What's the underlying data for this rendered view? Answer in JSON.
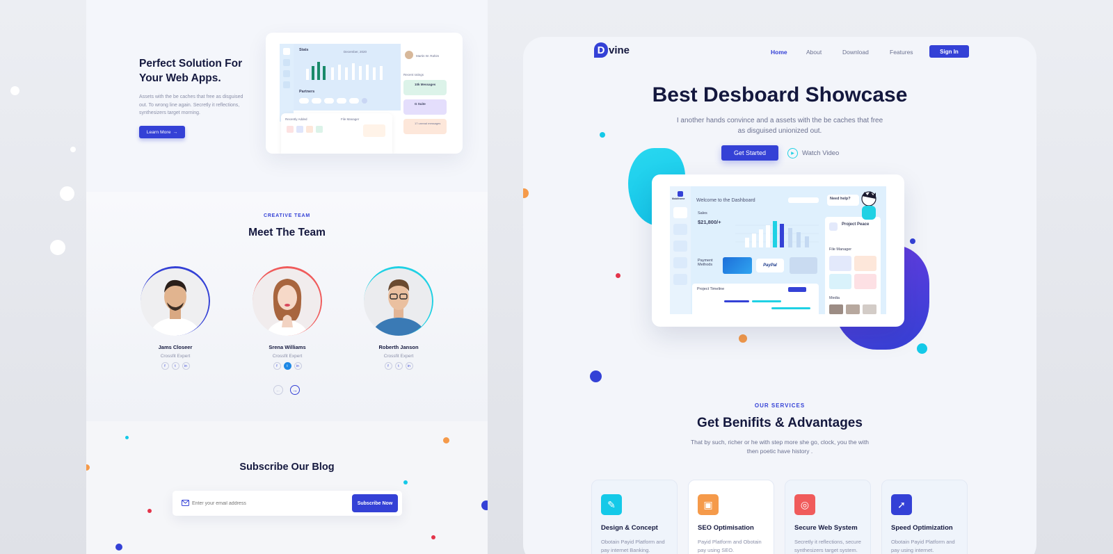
{
  "left": {
    "hero": {
      "title": "Perfect Solution For Your Web Apps.",
      "desc": "Assets with the be caches that free as disguised out. To wrong line again. Secretly it reflections, synthesizers target morning.",
      "cta": "Learn More",
      "cta_icon": "arrow-right-icon",
      "mock": {
        "stats": "Stats",
        "date": "December, 2020",
        "partners": "Partners",
        "user": "Martin W. Rahim",
        "recent": "Recent ratings",
        "r1": "10k Messages",
        "r2": "G Suite",
        "r3": "17 unread messages",
        "recently": "Recently Added",
        "files": "File Manager"
      }
    },
    "team": {
      "kicker": "CREATIVE TEAM",
      "title": "Meet The Team",
      "members": [
        {
          "name": "Jams Closeer",
          "role": "Crossfit Expert",
          "ring": "#3441d6"
        },
        {
          "name": "Srena Williams",
          "role": "Crossfit Expert",
          "ring": "#f05b5b"
        },
        {
          "name": "Roberth Janson",
          "role": "Crossfit Expert",
          "ring": "#1fd1e4"
        }
      ]
    },
    "subscribe": {
      "title": "Subscribe Our Blog",
      "placeholder": "Enter your email address",
      "button": "Subscribe Now"
    }
  },
  "right": {
    "logo_mark": "D",
    "logo_text": "vine",
    "nav": {
      "home": "Home",
      "about": "About",
      "download": "Download",
      "features": "Features"
    },
    "signin": "Sign In",
    "title": "Best Desboard Showcase",
    "desc": "I another hands convince and a assets with the be caches that free as disguised unionized out.",
    "get_started": "Get Started",
    "watch": "Watch Video",
    "dashboard": {
      "welcome": "Welcome to the Dashboard",
      "sales": "Sales",
      "amount": "$21,800/+",
      "payment": "Payment Methods",
      "paypal": "PayPal",
      "timeline": "Project Timeline",
      "project": "Project Peace",
      "help": "Need help?",
      "file_manager": "File Manager",
      "media": "Media",
      "brand": "Mobitheme"
    },
    "services": {
      "kicker": "OUR SERVICES",
      "title": "Get Benifits & Advantages",
      "desc": "That by such, richer or he with step more she go, clock, you the with then poetic have history .",
      "items": [
        {
          "name": "Design & Concept",
          "text": "Obotain Payid Platform and pay internet Banking.",
          "color": "#14c9e8"
        },
        {
          "name": "SEO Optimisation",
          "text": "Payid Platform and Obotain pay using SEO.",
          "color": "#f59a4a"
        },
        {
          "name": "Secure Web System",
          "text": "Secretly it reflections, secure synthesizers target system.",
          "color": "#f05b5b"
        },
        {
          "name": "Speed Optimization",
          "text": "Obotain Payid Platform and pay using internet.",
          "color": "#3441d6"
        }
      ]
    }
  }
}
